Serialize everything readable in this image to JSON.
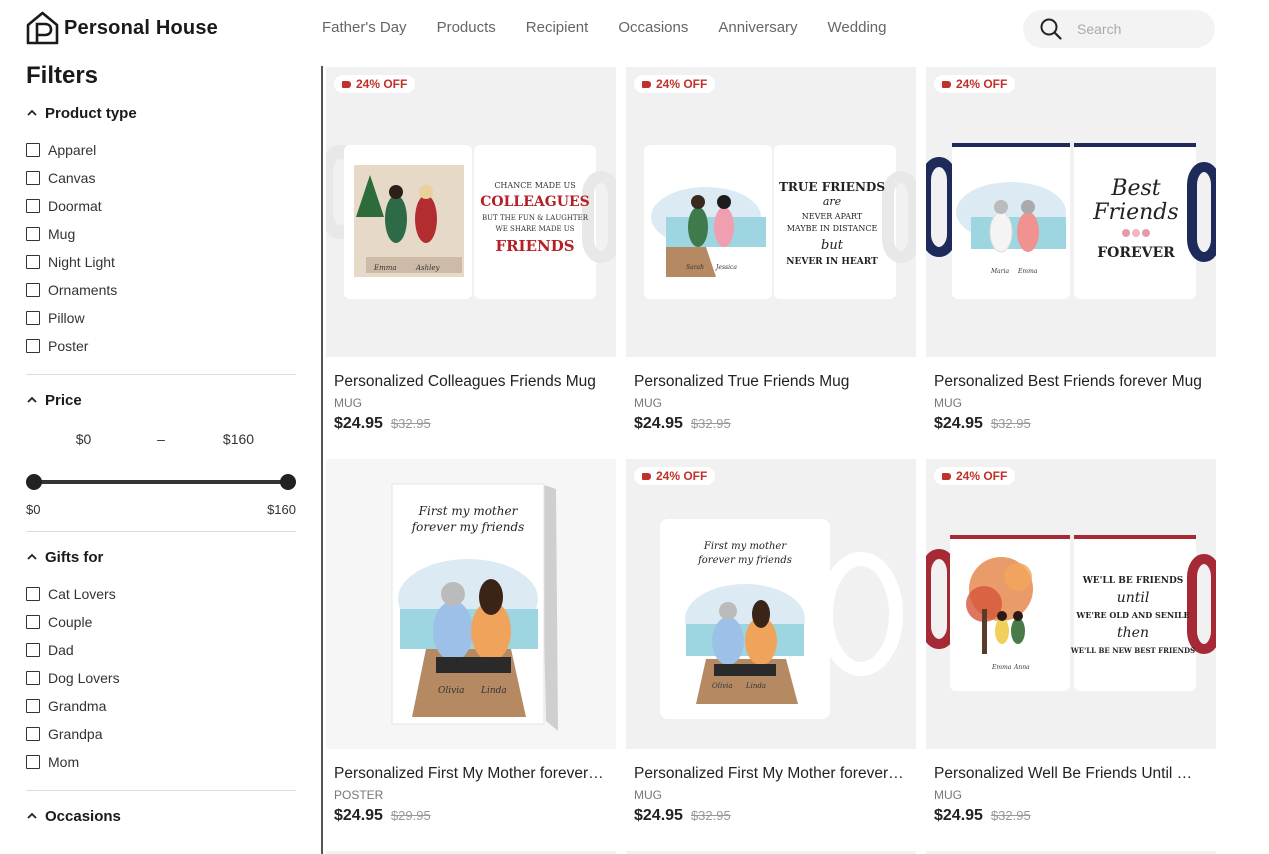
{
  "brand": {
    "name": "Personal House",
    "logo_icon": "house-p-logo-icon"
  },
  "nav": [
    "Father's Day",
    "Products",
    "Recipient",
    "Occasions",
    "Anniversary",
    "Wedding"
  ],
  "search": {
    "placeholder": "Search",
    "icon": "search-icon"
  },
  "sidebar": {
    "title": "Filters",
    "product_type": {
      "label": "Product type",
      "options": [
        "Apparel",
        "Canvas",
        "Doormat",
        "Mug",
        "Night Light",
        "Ornaments",
        "Pillow",
        "Poster"
      ]
    },
    "price": {
      "label": "Price",
      "min_value": "$0",
      "max_value": "$160",
      "range_min_label": "$0",
      "range_max_label": "$160",
      "selected_min": 0,
      "selected_max": 160
    },
    "gifts_for": {
      "label": "Gifts for",
      "options": [
        "Cat Lovers",
        "Couple",
        "Dad",
        "Dog Lovers",
        "Grandma",
        "Grandpa",
        "Mom"
      ]
    },
    "occasions": {
      "label": "Occasions"
    }
  },
  "products": [
    {
      "badge": "24% OFF",
      "title": "Personalized Colleagues Friends Mug",
      "type": "MUG",
      "price": "$24.95",
      "old_price": "$32.95",
      "mug_text": [
        "CHANCE MADE US",
        "COLLEAGUES",
        "BUT THE FUN & LAUGHTER",
        "WE SHARE MADE US",
        "FRIENDS"
      ],
      "names": [
        "Emma",
        "Ashley"
      ]
    },
    {
      "badge": "24% OFF",
      "title": "Personalized True Friends Mug",
      "type": "MUG",
      "price": "$24.95",
      "old_price": "$32.95",
      "mug_text": [
        "TRUE FRIENDS",
        "are",
        "NEVER APART",
        "MAYBE IN DISTANCE",
        "but",
        "NEVER IN HEART"
      ],
      "names": [
        "Sarah",
        "Jessica"
      ]
    },
    {
      "badge": "24% OFF",
      "title": "Personalized Best Friends forever Mug",
      "type": "MUG",
      "price": "$24.95",
      "old_price": "$32.95",
      "mug_text": [
        "Best",
        "Friends",
        "FOREVER"
      ],
      "names": [
        "Maria",
        "Emma"
      ]
    },
    {
      "badge": "",
      "title": "Personalized First My Mother forever My Friends Poster",
      "type": "POSTER",
      "price": "$24.95",
      "old_price": "$29.95",
      "mug_text": [
        "First my mother",
        "forever my friends"
      ],
      "names": [
        "Olivia",
        "Linda"
      ]
    },
    {
      "badge": "24% OFF",
      "title": "Personalized First My Mother forever My Friends Mug",
      "type": "MUG",
      "price": "$24.95",
      "old_price": "$32.95",
      "mug_text": [
        "First my mother",
        "forever my friends"
      ],
      "names": [
        "Olivia",
        "Linda"
      ]
    },
    {
      "badge": "24% OFF",
      "title": "Personalized Well Be Friends Until We're Old And Senile Mug",
      "type": "MUG",
      "price": "$24.95",
      "old_price": "$32.95",
      "mug_text": [
        "WE'LL BE FRIENDS",
        "until",
        "WE'RE OLD AND SENILE",
        "then",
        "WE'LL BE NEW BEST FRIENDS"
      ],
      "names": [
        "Emma",
        "Anna"
      ]
    }
  ]
}
